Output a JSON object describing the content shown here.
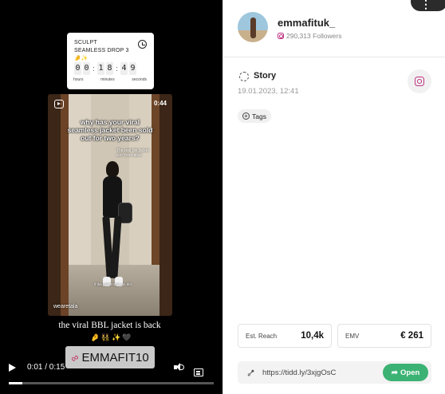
{
  "video": {
    "countdown": {
      "title": "SCULPT SEAMLESS DROP 3 🤌✨",
      "digits": [
        "0",
        "0",
        "1",
        "8",
        "4",
        "9"
      ],
      "units": [
        "hours",
        "minutes",
        "seconds"
      ]
    },
    "reel": {
      "duration": "0:44",
      "caption": "why has your viral seamless jacket been sold out for two years?",
      "subcaption": "The real bbl jacket isn't from aliex",
      "small_text": "if the jacket says on bbl",
      "handle": "wearetala"
    },
    "story_text": "the viral BBL jacket is back",
    "emoji_row": "🤌👯‍♀️✨🖤",
    "coupon_code": "EMMAFIT10",
    "player": {
      "time": "0:01 / 0:15",
      "progress": 0.067
    }
  },
  "profile": {
    "username": "emmafituk_",
    "followers": "290,313 Followers",
    "more_label": "⋮"
  },
  "post": {
    "type_label": "Story",
    "date": "19.01.2023, 12:41",
    "tags_label": "Tags"
  },
  "stats": {
    "reach_label": "Est. Reach",
    "reach_value": "10,4k",
    "emv_label": "EMV",
    "emv_value": "€ 261"
  },
  "link": {
    "url": "https://tidd.ly/3xjgOsC",
    "open_label": "Open"
  },
  "colors": {
    "accent_green": "#3bb273",
    "instagram": "#c13584"
  }
}
